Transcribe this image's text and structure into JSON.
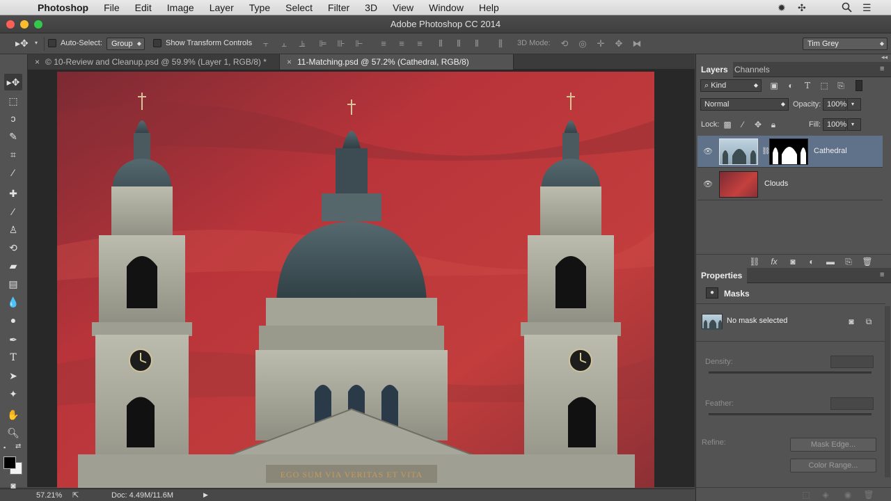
{
  "menubar": {
    "app_name": "Photoshop",
    "menus": [
      "File",
      "Edit",
      "Image",
      "Layer",
      "Type",
      "Select",
      "Filter",
      "3D",
      "View",
      "Window",
      "Help"
    ]
  },
  "window": {
    "title": "Adobe Photoshop CC 2014"
  },
  "options_bar": {
    "auto_select_label": "Auto-Select:",
    "auto_select_value": "Group",
    "transform_label": "Show Transform Controls",
    "mode_3d_label": "3D Mode:",
    "workspace": "Tim Grey"
  },
  "doc_tabs": [
    {
      "label": "© 10-Review and Cleanup.psd @ 59.9% (Layer 1, RGB/8) *",
      "active": false
    },
    {
      "label": "11-Matching.psd @ 57.2% (Cathedral, RGB/8)",
      "active": true
    }
  ],
  "image": {
    "inscription": "EGO SUM VIA VERITAS ET VITA"
  },
  "status_bar": {
    "zoom": "57.21%",
    "doc_size": "Doc: 4.49M/11.6M"
  },
  "layers_panel": {
    "tabs": [
      "Layers",
      "Channels"
    ],
    "filter_kind": "Kind",
    "blend_mode": "Normal",
    "opacity_label": "Opacity:",
    "opacity_value": "100%",
    "lock_label": "Lock:",
    "fill_label": "Fill:",
    "fill_value": "100%",
    "layers": [
      {
        "name": "Cathedral",
        "selected": true
      },
      {
        "name": "Clouds",
        "selected": false
      }
    ]
  },
  "properties_panel": {
    "title": "Properties",
    "section": "Masks",
    "status": "No mask selected",
    "density_label": "Density:",
    "feather_label": "Feather:",
    "refine_label": "Refine:",
    "mask_edge_button": "Mask Edge...",
    "color_range_button": "Color Range..."
  },
  "colors": {
    "selected_layer": "#5f7289",
    "sky_red": "#b8343a",
    "dome_slate": "#3f5258",
    "stone": "#a9a99c"
  }
}
